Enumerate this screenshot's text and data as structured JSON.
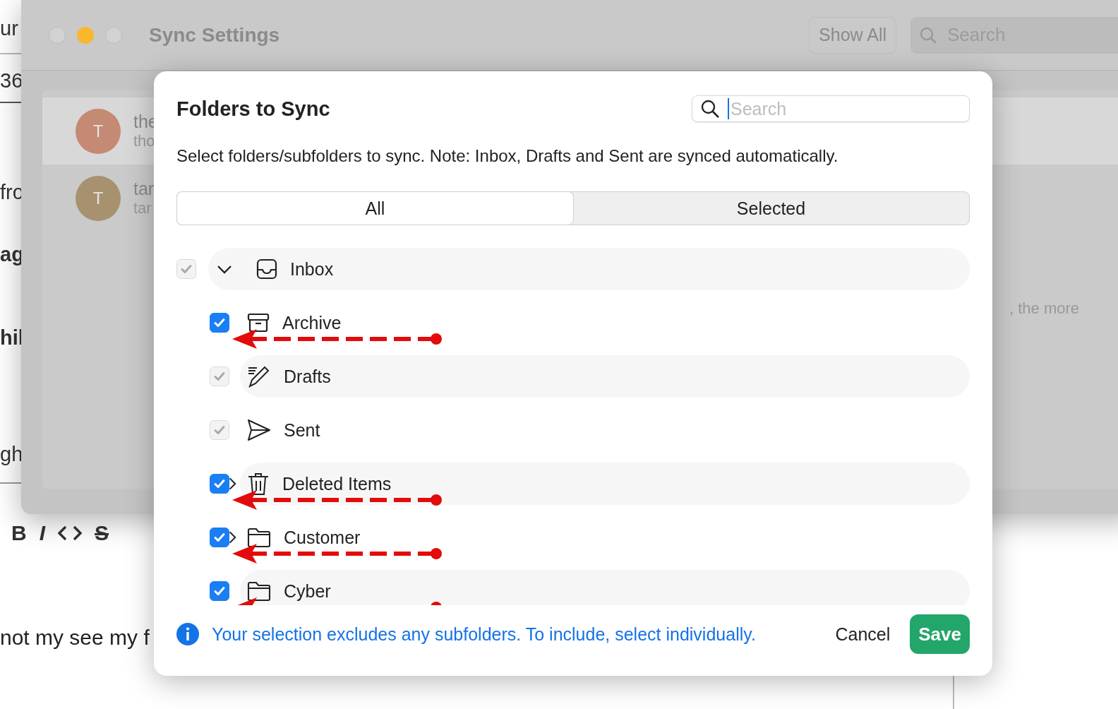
{
  "background_page": {
    "texts": [
      "ur",
      "36",
      "fro",
      "ag",
      "hil",
      "gh"
    ],
    "toolbar": [
      "B",
      "I",
      "S"
    ],
    "body_text": "not my see my f"
  },
  "settings_window": {
    "title": "Sync Settings",
    "show_all": "Show All",
    "search": {
      "placeholder": "Search"
    },
    "contacts": [
      {
        "name": "the",
        "detail": "tho",
        "initial": "T",
        "color": "#c48a74",
        "selected": true
      },
      {
        "name": "tar",
        "detail": "tar",
        "initial": "T",
        "color": "#a8916f",
        "selected": false
      }
    ],
    "side_text": ", the more"
  },
  "dialog": {
    "title": "Folders to Sync",
    "search": {
      "placeholder": "Search",
      "focused": true
    },
    "description": "Select folders/subfolders to sync. Note: Inbox, Drafts and Sent are synced automatically.",
    "tabs": [
      {
        "label": "All",
        "selected": true
      },
      {
        "label": "Selected",
        "selected": false
      }
    ],
    "folders": [
      {
        "name": "Inbox",
        "kind": "inbox",
        "checked": true,
        "disabled": true,
        "expanded": true,
        "children": [
          {
            "name": "Archive",
            "kind": "archive",
            "checked": true,
            "disabled": false,
            "arrowed": true
          },
          {
            "name": "Drafts",
            "kind": "drafts",
            "checked": true,
            "disabled": true,
            "arrowed": false
          },
          {
            "name": "Sent",
            "kind": "sent",
            "checked": true,
            "disabled": true,
            "arrowed": false
          },
          {
            "name": "Deleted Items",
            "kind": "trash",
            "checked": true,
            "disabled": false,
            "expanded": false,
            "arrowed": true
          },
          {
            "name": "Customer",
            "kind": "folder",
            "checked": true,
            "disabled": false,
            "expanded": false,
            "arrowed": true
          },
          {
            "name": "Cyber",
            "kind": "folder",
            "checked": true,
            "disabled": false,
            "arrowed": true
          }
        ]
      }
    ],
    "note": "Your selection excludes any subfolders. To include, select individually.",
    "buttons": {
      "cancel": "Cancel",
      "save": "Save"
    }
  }
}
